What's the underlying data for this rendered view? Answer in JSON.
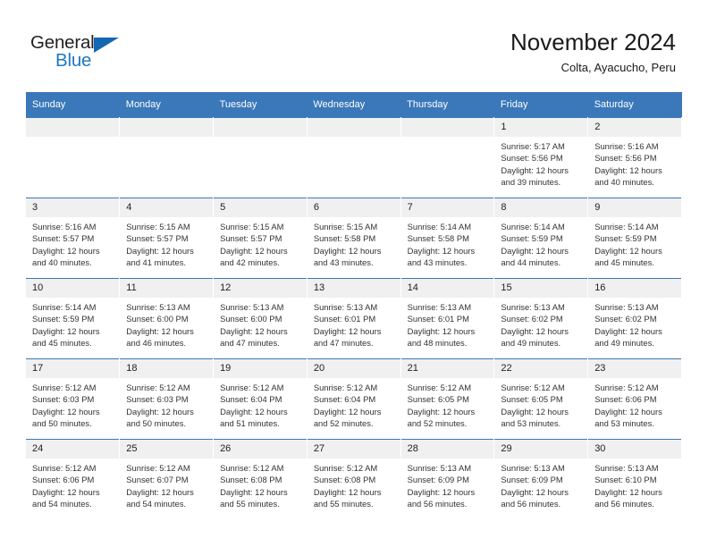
{
  "brand": {
    "name_part1": "General",
    "name_part2": "Blue",
    "triangle_color": "#1567b3",
    "blue_color": "#1f78c1"
  },
  "header": {
    "title": "November 2024",
    "subtitle": "Colta, Ayacucho, Peru"
  },
  "theme": {
    "header_blue": "#3a78b9",
    "daynum_band": "#f0f0f0",
    "text": "#333333"
  },
  "weekdays": [
    "Sunday",
    "Monday",
    "Tuesday",
    "Wednesday",
    "Thursday",
    "Friday",
    "Saturday"
  ],
  "labels": {
    "sunrise": "Sunrise:",
    "sunset": "Sunset:",
    "daylight": "Daylight:"
  },
  "weeks": [
    [
      {
        "day": "",
        "sunrise": "",
        "sunset": "",
        "daylight": "",
        "empty": true
      },
      {
        "day": "",
        "sunrise": "",
        "sunset": "",
        "daylight": "",
        "empty": true
      },
      {
        "day": "",
        "sunrise": "",
        "sunset": "",
        "daylight": "",
        "empty": true
      },
      {
        "day": "",
        "sunrise": "",
        "sunset": "",
        "daylight": "",
        "empty": true
      },
      {
        "day": "",
        "sunrise": "",
        "sunset": "",
        "daylight": "",
        "empty": true
      },
      {
        "day": "1",
        "sunrise": "Sunrise: 5:17 AM",
        "sunset": "Sunset: 5:56 PM",
        "daylight": "Daylight: 12 hours and 39 minutes.",
        "empty": false
      },
      {
        "day": "2",
        "sunrise": "Sunrise: 5:16 AM",
        "sunset": "Sunset: 5:56 PM",
        "daylight": "Daylight: 12 hours and 40 minutes.",
        "empty": false
      }
    ],
    [
      {
        "day": "3",
        "sunrise": "Sunrise: 5:16 AM",
        "sunset": "Sunset: 5:57 PM",
        "daylight": "Daylight: 12 hours and 40 minutes.",
        "empty": false
      },
      {
        "day": "4",
        "sunrise": "Sunrise: 5:15 AM",
        "sunset": "Sunset: 5:57 PM",
        "daylight": "Daylight: 12 hours and 41 minutes.",
        "empty": false
      },
      {
        "day": "5",
        "sunrise": "Sunrise: 5:15 AM",
        "sunset": "Sunset: 5:57 PM",
        "daylight": "Daylight: 12 hours and 42 minutes.",
        "empty": false
      },
      {
        "day": "6",
        "sunrise": "Sunrise: 5:15 AM",
        "sunset": "Sunset: 5:58 PM",
        "daylight": "Daylight: 12 hours and 43 minutes.",
        "empty": false
      },
      {
        "day": "7",
        "sunrise": "Sunrise: 5:14 AM",
        "sunset": "Sunset: 5:58 PM",
        "daylight": "Daylight: 12 hours and 43 minutes.",
        "empty": false
      },
      {
        "day": "8",
        "sunrise": "Sunrise: 5:14 AM",
        "sunset": "Sunset: 5:59 PM",
        "daylight": "Daylight: 12 hours and 44 minutes.",
        "empty": false
      },
      {
        "day": "9",
        "sunrise": "Sunrise: 5:14 AM",
        "sunset": "Sunset: 5:59 PM",
        "daylight": "Daylight: 12 hours and 45 minutes.",
        "empty": false
      }
    ],
    [
      {
        "day": "10",
        "sunrise": "Sunrise: 5:14 AM",
        "sunset": "Sunset: 5:59 PM",
        "daylight": "Daylight: 12 hours and 45 minutes.",
        "empty": false
      },
      {
        "day": "11",
        "sunrise": "Sunrise: 5:13 AM",
        "sunset": "Sunset: 6:00 PM",
        "daylight": "Daylight: 12 hours and 46 minutes.",
        "empty": false
      },
      {
        "day": "12",
        "sunrise": "Sunrise: 5:13 AM",
        "sunset": "Sunset: 6:00 PM",
        "daylight": "Daylight: 12 hours and 47 minutes.",
        "empty": false
      },
      {
        "day": "13",
        "sunrise": "Sunrise: 5:13 AM",
        "sunset": "Sunset: 6:01 PM",
        "daylight": "Daylight: 12 hours and 47 minutes.",
        "empty": false
      },
      {
        "day": "14",
        "sunrise": "Sunrise: 5:13 AM",
        "sunset": "Sunset: 6:01 PM",
        "daylight": "Daylight: 12 hours and 48 minutes.",
        "empty": false
      },
      {
        "day": "15",
        "sunrise": "Sunrise: 5:13 AM",
        "sunset": "Sunset: 6:02 PM",
        "daylight": "Daylight: 12 hours and 49 minutes.",
        "empty": false
      },
      {
        "day": "16",
        "sunrise": "Sunrise: 5:13 AM",
        "sunset": "Sunset: 6:02 PM",
        "daylight": "Daylight: 12 hours and 49 minutes.",
        "empty": false
      }
    ],
    [
      {
        "day": "17",
        "sunrise": "Sunrise: 5:12 AM",
        "sunset": "Sunset: 6:03 PM",
        "daylight": "Daylight: 12 hours and 50 minutes.",
        "empty": false
      },
      {
        "day": "18",
        "sunrise": "Sunrise: 5:12 AM",
        "sunset": "Sunset: 6:03 PM",
        "daylight": "Daylight: 12 hours and 50 minutes.",
        "empty": false
      },
      {
        "day": "19",
        "sunrise": "Sunrise: 5:12 AM",
        "sunset": "Sunset: 6:04 PM",
        "daylight": "Daylight: 12 hours and 51 minutes.",
        "empty": false
      },
      {
        "day": "20",
        "sunrise": "Sunrise: 5:12 AM",
        "sunset": "Sunset: 6:04 PM",
        "daylight": "Daylight: 12 hours and 52 minutes.",
        "empty": false
      },
      {
        "day": "21",
        "sunrise": "Sunrise: 5:12 AM",
        "sunset": "Sunset: 6:05 PM",
        "daylight": "Daylight: 12 hours and 52 minutes.",
        "empty": false
      },
      {
        "day": "22",
        "sunrise": "Sunrise: 5:12 AM",
        "sunset": "Sunset: 6:05 PM",
        "daylight": "Daylight: 12 hours and 53 minutes.",
        "empty": false
      },
      {
        "day": "23",
        "sunrise": "Sunrise: 5:12 AM",
        "sunset": "Sunset: 6:06 PM",
        "daylight": "Daylight: 12 hours and 53 minutes.",
        "empty": false
      }
    ],
    [
      {
        "day": "24",
        "sunrise": "Sunrise: 5:12 AM",
        "sunset": "Sunset: 6:06 PM",
        "daylight": "Daylight: 12 hours and 54 minutes.",
        "empty": false
      },
      {
        "day": "25",
        "sunrise": "Sunrise: 5:12 AM",
        "sunset": "Sunset: 6:07 PM",
        "daylight": "Daylight: 12 hours and 54 minutes.",
        "empty": false
      },
      {
        "day": "26",
        "sunrise": "Sunrise: 5:12 AM",
        "sunset": "Sunset: 6:08 PM",
        "daylight": "Daylight: 12 hours and 55 minutes.",
        "empty": false
      },
      {
        "day": "27",
        "sunrise": "Sunrise: 5:12 AM",
        "sunset": "Sunset: 6:08 PM",
        "daylight": "Daylight: 12 hours and 55 minutes.",
        "empty": false
      },
      {
        "day": "28",
        "sunrise": "Sunrise: 5:13 AM",
        "sunset": "Sunset: 6:09 PM",
        "daylight": "Daylight: 12 hours and 56 minutes.",
        "empty": false
      },
      {
        "day": "29",
        "sunrise": "Sunrise: 5:13 AM",
        "sunset": "Sunset: 6:09 PM",
        "daylight": "Daylight: 12 hours and 56 minutes.",
        "empty": false
      },
      {
        "day": "30",
        "sunrise": "Sunrise: 5:13 AM",
        "sunset": "Sunset: 6:10 PM",
        "daylight": "Daylight: 12 hours and 56 minutes.",
        "empty": false
      }
    ]
  ]
}
